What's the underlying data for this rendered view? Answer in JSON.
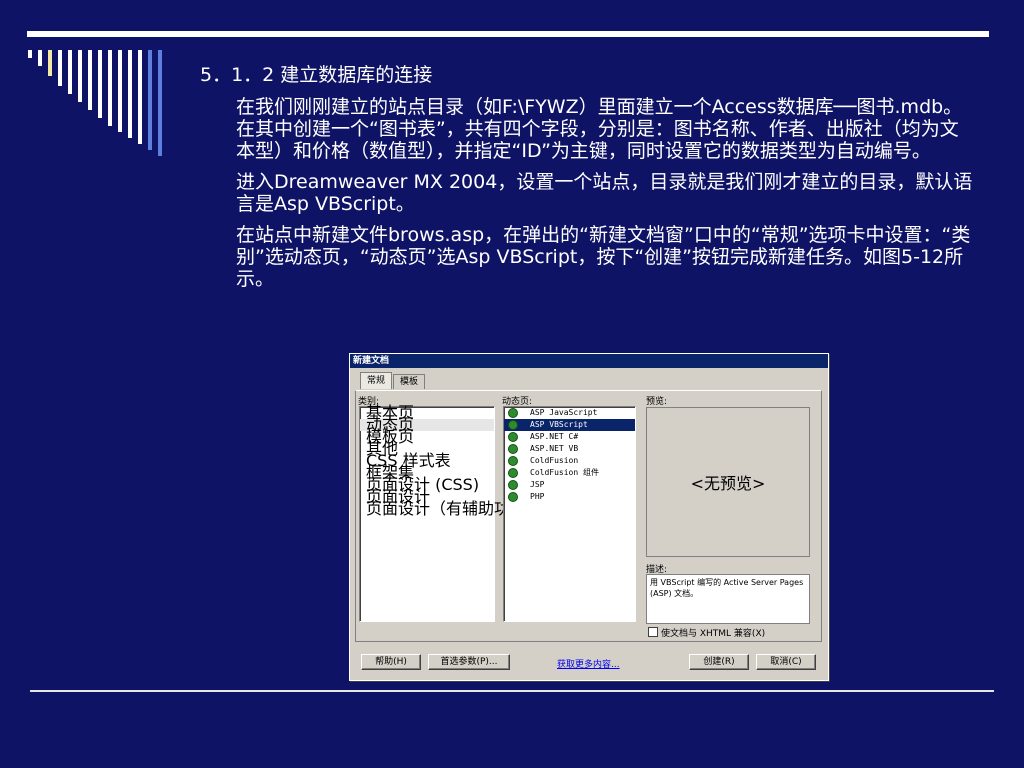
{
  "slide": {
    "heading": "5．1．2  建立数据库的连接",
    "paragraphs": [
      "在我们刚刚建立的站点目录（如F:\\FYWZ）里面建立一个Access数据库──图书.mdb。在其中创建一个“图书表”，共有四个字段，分别是：图书名称、作者、出版社（均为文本型）和价格（数值型），并指定“ID”为主键，同时设置它的数据类型为自动编号。",
      "进入Dreamweaver MX 2004，设置一个站点，目录就是我们刚才建立的目录，默认语言是Asp VBScript。",
      "在站点中新建文件brows.asp，在弹出的“新建文档窗”口中的“常规”选项卡中设置：“类别”选动态页，“动态页”选Asp VBScript，按下“创建”按钮完成新建任务。如图5-12所示。"
    ]
  },
  "dialog": {
    "title": "新建文档",
    "tabs": [
      "常规",
      "模板"
    ],
    "category_label": "类别:",
    "dynamic_label": "动态页:",
    "preview_label": "预览:",
    "categories": [
      "基本页",
      "动态页",
      "模板页",
      "其他",
      "CSS 样式表",
      "框架集",
      "页面设计 (CSS)",
      "页面设计",
      "页面设计（有辅助功能的）"
    ],
    "dynamic_pages": [
      "ASP JavaScript",
      "ASP VBScript",
      "ASP.NET C#",
      "ASP.NET VB",
      "ColdFusion",
      "ColdFusion 组件",
      "JSP",
      "PHP"
    ],
    "selected_dynamic": "ASP VBScript",
    "no_preview": "<无预览>",
    "description_label": "描述:",
    "description": "用 VBScript 编写的 Active Server Pages (ASP) 文档。",
    "xhtml_checkbox": "使文档与 XHTML 兼容(X)",
    "buttons": {
      "help": "帮助(H)",
      "prefs": "首选参数(P)...",
      "more": "获取更多内容...",
      "create": "创建(R)",
      "cancel": "取消(C)"
    }
  }
}
